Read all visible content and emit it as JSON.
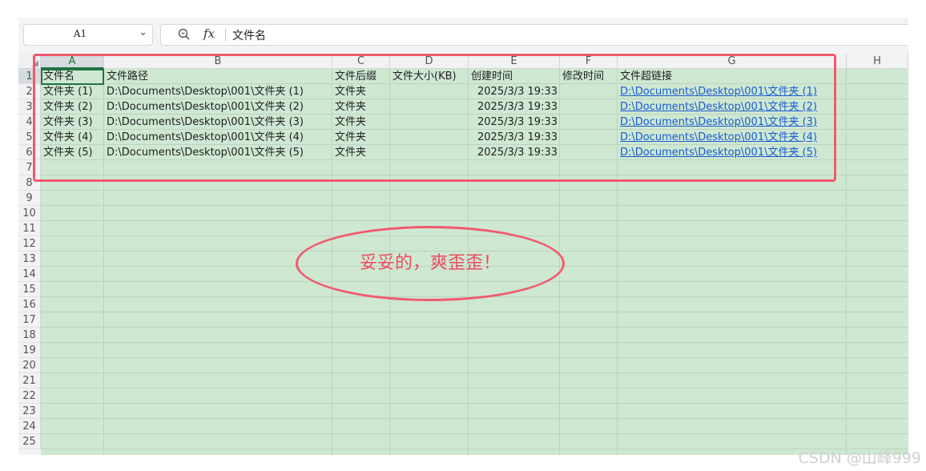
{
  "formula_bar": {
    "name_box": "A1",
    "fx_label": "fx",
    "content": "文件名"
  },
  "columns": [
    "A",
    "B",
    "C",
    "D",
    "E",
    "F",
    "G",
    "H"
  ],
  "row_numbers": [
    "1",
    "2",
    "3",
    "4",
    "5",
    "6",
    "7",
    "8",
    "9",
    "10",
    "11",
    "12",
    "13",
    "14",
    "15",
    "16",
    "17",
    "18",
    "19",
    "20",
    "21",
    "22",
    "23",
    "24",
    "25"
  ],
  "rows": [
    {
      "a": "文件名",
      "b": "文件路径",
      "c": "文件后缀",
      "d": "文件大小(KB)",
      "e": "创建时间",
      "f": "修改时间",
      "g": "文件超链接"
    },
    {
      "a": "文件夹 (1)",
      "b": "D:\\Documents\\Desktop\\001\\文件夹 (1)",
      "c": "文件夹",
      "d": "",
      "e": "2025/3/3 19:33",
      "f": "",
      "g": "D:\\Documents\\Desktop\\001\\文件夹 (1)"
    },
    {
      "a": "文件夹 (2)",
      "b": "D:\\Documents\\Desktop\\001\\文件夹 (2)",
      "c": "文件夹",
      "d": "",
      "e": "2025/3/3 19:33",
      "f": "",
      "g": "D:\\Documents\\Desktop\\001\\文件夹 (2)"
    },
    {
      "a": "文件夹 (3)",
      "b": "D:\\Documents\\Desktop\\001\\文件夹 (3)",
      "c": "文件夹",
      "d": "",
      "e": "2025/3/3 19:33",
      "f": "",
      "g": "D:\\Documents\\Desktop\\001\\文件夹 (3)"
    },
    {
      "a": "文件夹 (4)",
      "b": "D:\\Documents\\Desktop\\001\\文件夹 (4)",
      "c": "文件夹",
      "d": "",
      "e": "2025/3/3 19:33",
      "f": "",
      "g": "D:\\Documents\\Desktop\\001\\文件夹 (4)"
    },
    {
      "a": "文件夹 (5)",
      "b": "D:\\Documents\\Desktop\\001\\文件夹 (5)",
      "c": "文件夹",
      "d": "",
      "e": "2025/3/3 19:33",
      "f": "",
      "g": "D:\\Documents\\Desktop\\001\\文件夹 (5)"
    }
  ],
  "annotation": {
    "text": "妥妥的，爽歪歪！",
    "color": "#ef4a5e"
  },
  "watermark": "CSDN @山峰999",
  "colors": {
    "sheet_fill": "#cee8d2",
    "active_cell": "#217346",
    "link": "#1a5bd1",
    "highlight": "#f25a6c"
  }
}
